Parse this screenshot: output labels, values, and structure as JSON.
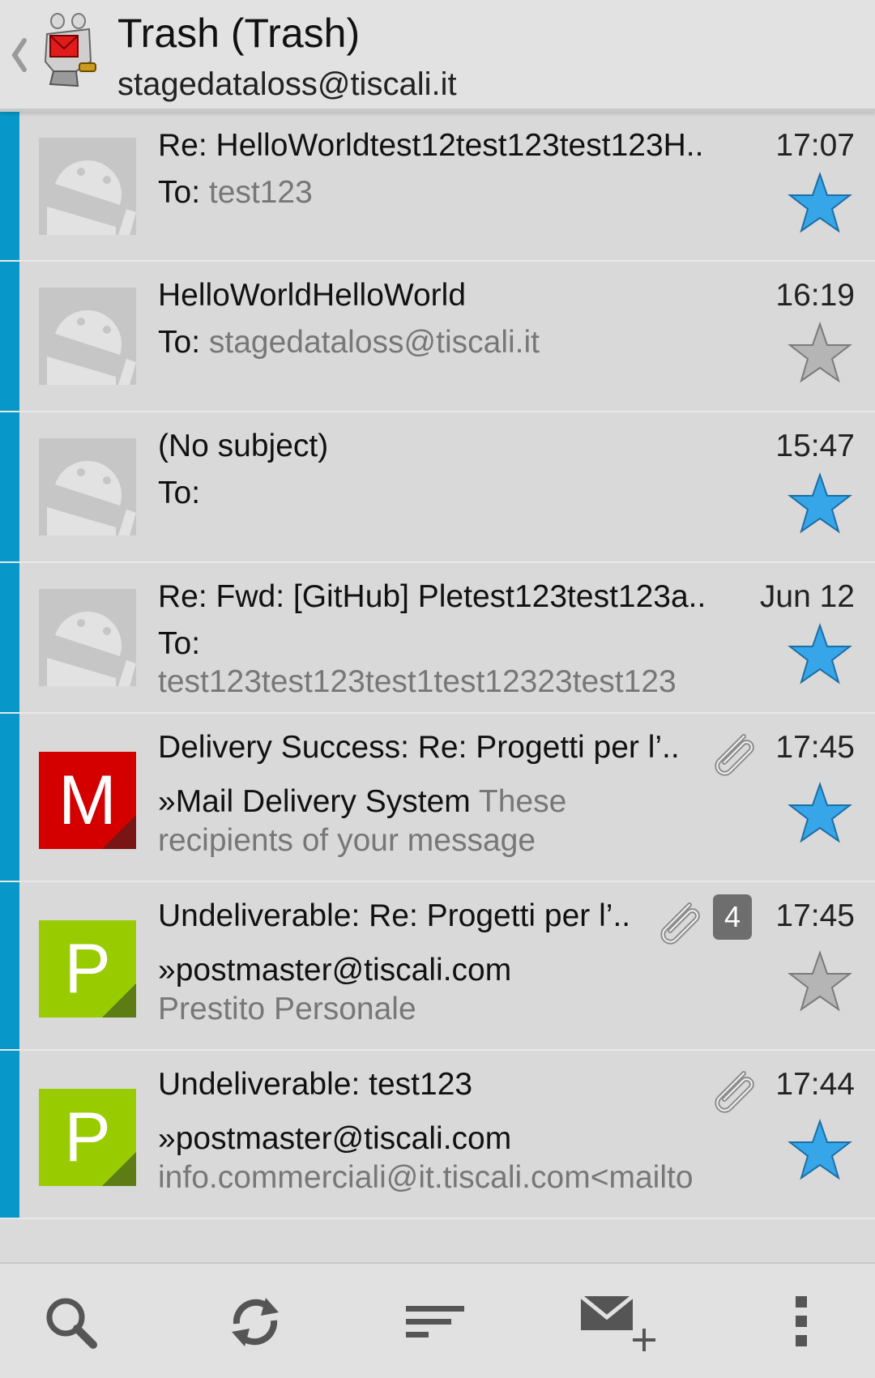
{
  "header": {
    "title": "Trash (Trash)",
    "account": "stagedataloss@tiscali.it"
  },
  "colors": {
    "unread_accent": "#0798c9",
    "star_on": "#36a6e8",
    "star_off": "#b5b5b5",
    "avatar_m": "#d40000",
    "avatar_p": "#99cc00"
  },
  "messages": [
    {
      "subject": "Re: HelloWorldtest12test123test123H..",
      "to_label": "To:",
      "to_value": "test123",
      "time": "17:07",
      "starred": true,
      "avatar": "android"
    },
    {
      "subject": "HelloWorldHelloWorld",
      "to_label": "To:",
      "to_value": "stagedataloss@tiscali.it",
      "time": "16:19",
      "starred": false,
      "avatar": "android"
    },
    {
      "subject": "(No subject)",
      "to_label": "To:",
      "to_value": "",
      "time": "15:47",
      "starred": true,
      "avatar": "android"
    },
    {
      "subject": "Re: Fwd: [GitHub] Pletest123test123a..",
      "to_label": "To:",
      "to_value": "test123test123test1test12323test123",
      "time": "Jun 12",
      "starred": true,
      "avatar": "android"
    },
    {
      "subject": "Delivery Success: Re: Progetti per l’..",
      "sender": "»Mail Delivery System",
      "preview_1": "These",
      "preview_2": "recipients of your message",
      "time": "17:45",
      "starred": true,
      "attachment": true,
      "avatar_letter": "M"
    },
    {
      "subject": "Undeliverable: Re: Progetti per l’..",
      "sender": "»postmaster@tiscali.com",
      "preview_2": "Prestito Personale",
      "time": "17:45",
      "starred": false,
      "attachment": true,
      "thread_count": "4",
      "avatar_letter": "P"
    },
    {
      "subject": "Undeliverable: test123",
      "sender": "»postmaster@tiscali.com",
      "preview_2": "info.commerciali@it.tiscali.com<mailto",
      "time": "17:44",
      "starred": true,
      "attachment": true,
      "avatar_letter": "P"
    }
  ],
  "toolbar": {
    "icons": [
      "search-icon",
      "refresh-icon",
      "sort-icon",
      "compose-icon",
      "overflow-menu-icon"
    ]
  }
}
